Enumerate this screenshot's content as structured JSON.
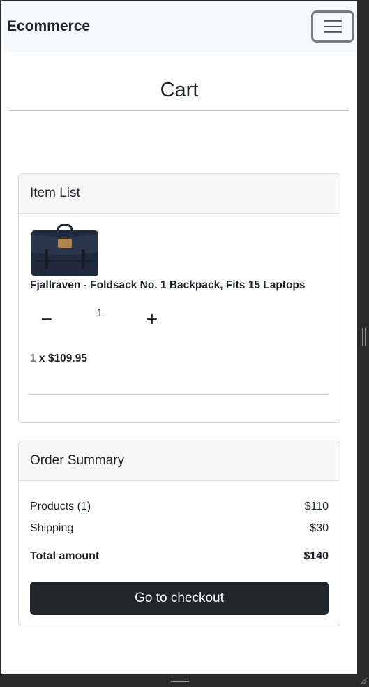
{
  "navbar": {
    "brand": "Ecommerce",
    "menu_icon": "hamburger-menu-icon"
  },
  "page": {
    "title": "Cart"
  },
  "item_list": {
    "header": "Item List",
    "items": [
      {
        "name": "Fjallraven - Foldsack No. 1 Backpack, Fits 15 Laptops",
        "image_icon": "navy-backpack-image",
        "quantity": "1",
        "minus_label": "−",
        "plus_label": "+",
        "line_qty": "1",
        "line_price": " x $109.95"
      }
    ]
  },
  "order_summary": {
    "header": "Order Summary",
    "products_label": "Products (1)",
    "products_value": "$110",
    "shipping_label": "Shipping",
    "shipping_value": "$30",
    "total_label": "Total amount",
    "total_value": "$140",
    "checkout_label": "Go to checkout"
  },
  "colors": {
    "navbar_bg": "#f8f9fa",
    "button_dark": "#212529",
    "backpack": "#1f2a3d"
  }
}
